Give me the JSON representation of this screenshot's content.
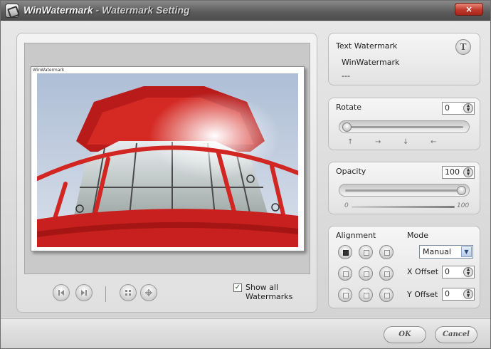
{
  "window": {
    "app_name": "WinWatermark",
    "title_separator": "-",
    "title_suffix": "Watermark Setting",
    "close_label": "×"
  },
  "preview": {
    "watermark_text": "WinWatermark",
    "show_all_label": "Show all Watermarks",
    "show_all_checked": true,
    "check_glyph": "✓",
    "toolbar_icons": [
      "first-page-icon",
      "last-page-icon",
      "fit-icon",
      "actual-size-icon"
    ]
  },
  "text_watermark": {
    "title": "Text Watermark",
    "line1": "WinWatermark",
    "line2": "---",
    "button_label": "T"
  },
  "rotate": {
    "title": "Rotate",
    "value": "0",
    "slider_fraction": 0.0,
    "directions": [
      "↑",
      "→",
      "↓",
      "←"
    ]
  },
  "opacity": {
    "title": "Opacity",
    "value": "100",
    "slider_fraction": 1.0,
    "scale_min": "0",
    "scale_max": "100"
  },
  "alignment": {
    "title": "Alignment",
    "selected_index": 0
  },
  "mode": {
    "title": "Mode",
    "selected": "Manual",
    "x_offset_label": "X Offset",
    "x_offset_value": "0",
    "y_offset_label": "Y Offset",
    "y_offset_value": "0"
  },
  "footer": {
    "ok_label": "OK",
    "cancel_label": "Cancel"
  },
  "colors": {
    "lighthouse_red": "#c8201e",
    "sky": "#b7c7dc"
  }
}
